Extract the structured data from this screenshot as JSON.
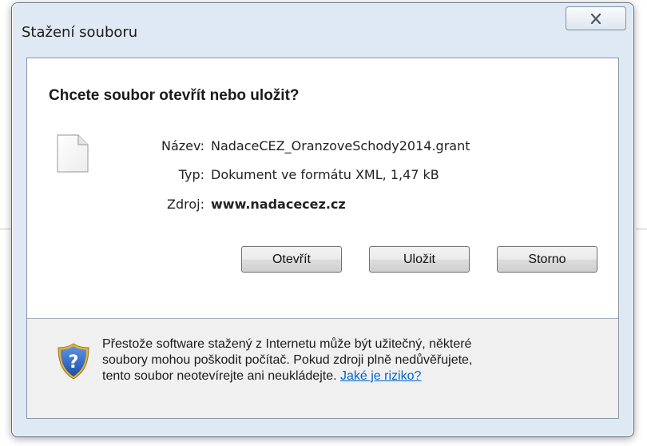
{
  "window": {
    "title": "Stažení souboru",
    "close_icon": "close-x-icon"
  },
  "dialog": {
    "heading": "Chcete soubor otevřít nebo uložit?",
    "file_icon": "blank-document-icon",
    "fields": {
      "name_label": "Název:",
      "name_value": "NadaceCEZ_OranzoveSchody2014.grant",
      "type_label": "Typ:",
      "type_value": "Dokument ve formátu XML, 1,47 kB",
      "source_label": "Zdroj:",
      "source_value": "www.nadacecez.cz"
    },
    "buttons": {
      "open": "Otevřít",
      "save": "Uložit",
      "cancel": "Storno"
    }
  },
  "footer": {
    "shield_icon": "shield-question-icon",
    "line1": "Přestože software stažený z Internetu může být užitečný, některé",
    "line2": "soubory mohou poškodit počítač. Pokud zdroji plně nedůvěřujete,",
    "line3_prefix": "tento soubor neotevírejte ani neukládejte.",
    "link_text": "Jaké je riziko?"
  },
  "colors": {
    "frame": "#dfe9f3",
    "footer_bg": "#f0f0f0",
    "link": "#0066cc",
    "shield_blue": "#1f5fbf",
    "shield_gold": "#e3b33a"
  }
}
